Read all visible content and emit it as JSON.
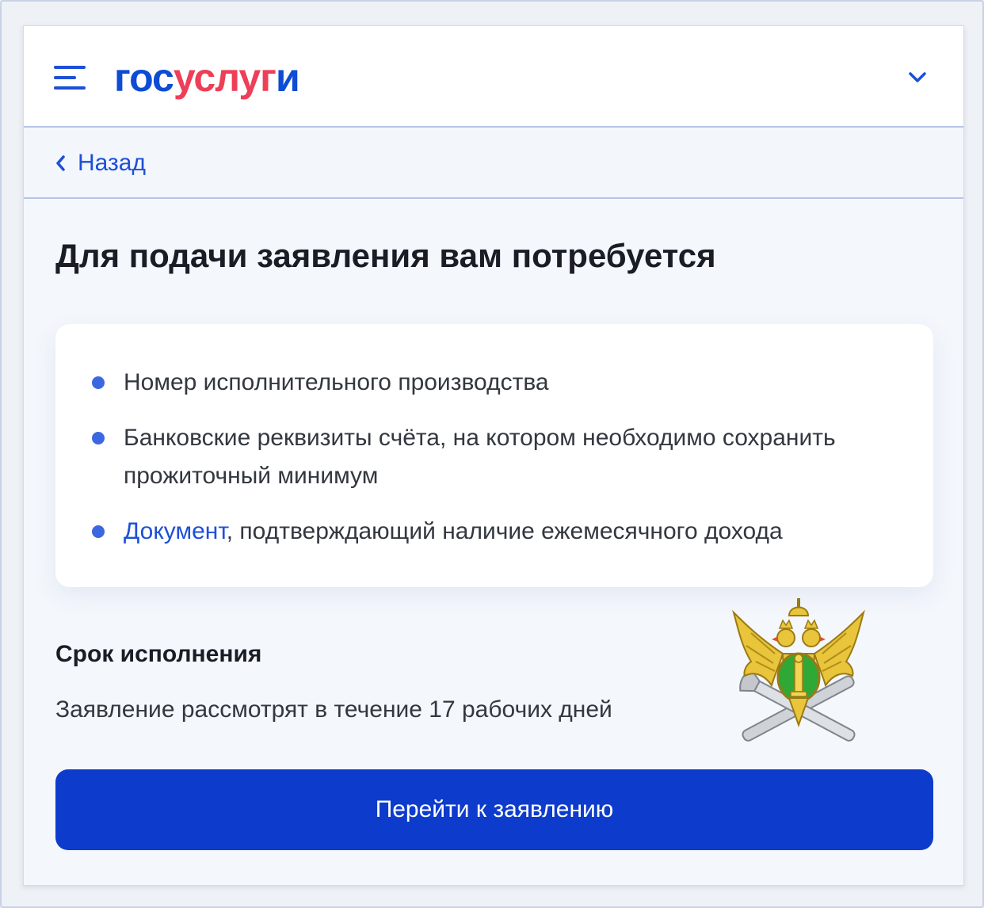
{
  "header": {
    "logo": {
      "part1": "гос",
      "part2": "услуг",
      "part3": "и"
    },
    "menu_icon": "hamburger-menu-icon",
    "dropdown_icon": "chevron-down-icon"
  },
  "navigation": {
    "back_label": "Назад",
    "back_icon": "chevron-left-icon"
  },
  "main": {
    "title": "Для подачи заявления вам потребуется",
    "requirements": [
      {
        "text": "Номер исполнительного производства"
      },
      {
        "text": "Банковские реквизиты счёта, на котором необходимо сохранить прожиточный минимум"
      },
      {
        "link": "Документ",
        "text": ", подтверждающий наличие ежемесячного дохода"
      }
    ],
    "deadline": {
      "title": "Срок исполнения",
      "text": "Заявление рассмотрят в течение 17 рабочих дней"
    },
    "emblem_icon": "fssp-emblem-icon",
    "cta_label": "Перейти к заявлению"
  },
  "colors": {
    "brand_blue": "#0d4cd3",
    "brand_red": "#ee3f58",
    "button": "#0d3ccc",
    "bullet": "#3b68e0"
  }
}
